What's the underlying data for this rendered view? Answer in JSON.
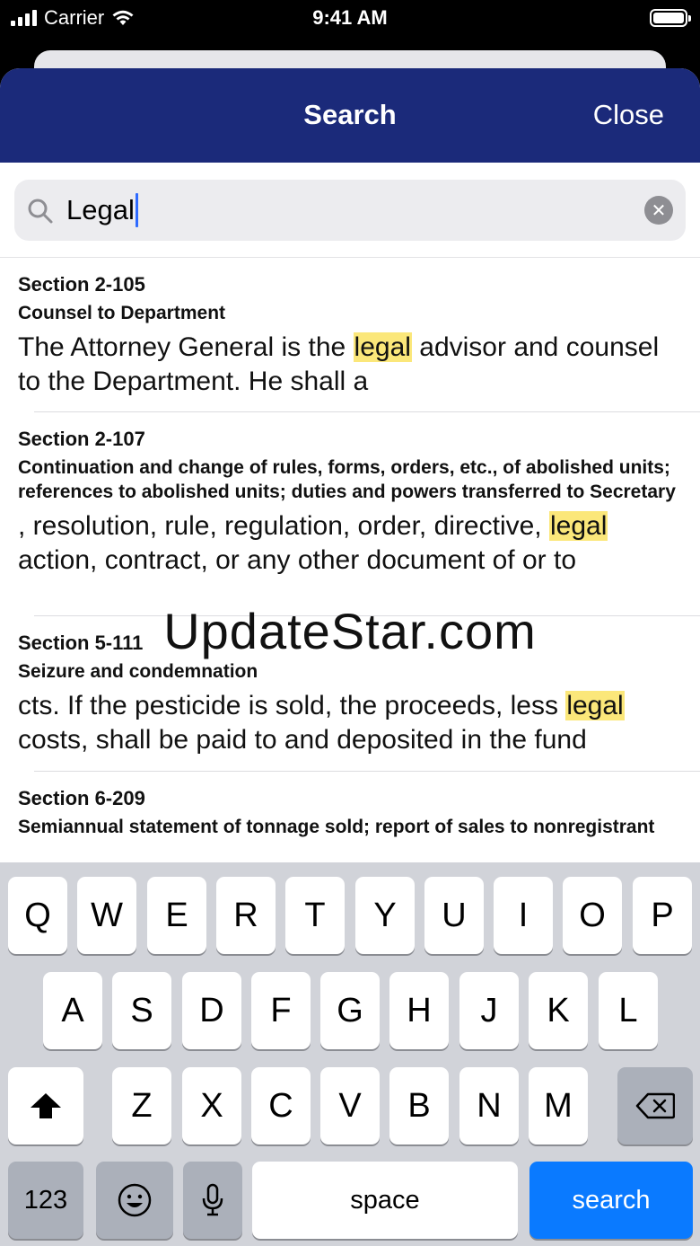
{
  "status_bar": {
    "carrier": "Carrier",
    "time": "9:41 AM"
  },
  "nav": {
    "title": "Search",
    "close_label": "Close"
  },
  "search": {
    "value": "Legal"
  },
  "results": [
    {
      "section": "Section 2-105",
      "heading": "Counsel to Department",
      "snippet_before": "The Attorney General is the ",
      "highlight": "legal",
      "snippet_after": " advisor and counsel to the Department. He shall a"
    },
    {
      "section": "Section 2-107",
      "heading": "Continuation and change of rules, forms, orders, etc., of abolished units; references to abolished units; duties and powers transferred to Secretary",
      "snippet_before": ", resolution, rule, regulation, order, directive, ",
      "highlight": "legal",
      "snippet_after": " action, contract, or any other document of or to"
    },
    {
      "section": "Section 5-111",
      "heading": "Seizure and condemnation",
      "snippet_before": "cts. If the pesticide is sold, the proceeds, less ",
      "highlight": "legal",
      "snippet_after": " costs, shall be paid to and deposited in the fund"
    },
    {
      "section": "Section 6-209",
      "heading": "Semiannual statement of tonnage sold; report of sales to nonregistrant",
      "snippet_before": "",
      "highlight": "",
      "snippet_after": ""
    }
  ],
  "watermark": "UpdateStar.com",
  "keyboard": {
    "row1": [
      "Q",
      "W",
      "E",
      "R",
      "T",
      "Y",
      "U",
      "I",
      "O",
      "P"
    ],
    "row2": [
      "A",
      "S",
      "D",
      "F",
      "G",
      "H",
      "J",
      "K",
      "L"
    ],
    "row3": [
      "Z",
      "X",
      "C",
      "V",
      "B",
      "N",
      "M"
    ],
    "numbers_label": "123",
    "space_label": "space",
    "search_label": "search"
  }
}
